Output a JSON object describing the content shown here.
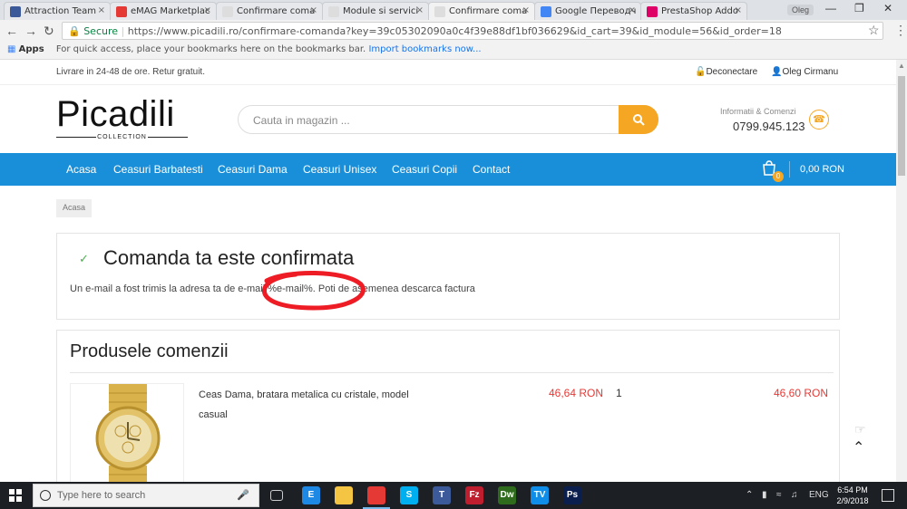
{
  "browser": {
    "tabs": [
      {
        "title": "Attraction Team",
        "color": "#3b5998",
        "active": false
      },
      {
        "title": "eMAG Marketplac",
        "color": "#e53935",
        "active": false
      },
      {
        "title": "Confirmare coma",
        "color": "#dddddd",
        "active": false
      },
      {
        "title": "Module si servici",
        "color": "#dddddd",
        "active": false
      },
      {
        "title": "Confirmare coma",
        "color": "#dddddd",
        "active": true
      },
      {
        "title": "Google Переводч",
        "color": "#4285f4",
        "active": false
      },
      {
        "title": "PrestaShop Addo",
        "color": "#df0067",
        "active": false
      }
    ],
    "profile": "Oleg",
    "secure_label": "Secure",
    "url": "https://www.picadili.ro/confirmare-comanda?key=39c05302090a0c4f39e88df1bf036629&id_cart=39&id_module=56&id_order=18",
    "bookmarks": {
      "apps": "Apps",
      "hint": "For quick access, place your bookmarks here on the bookmarks bar.",
      "import_link": "Import bookmarks now..."
    }
  },
  "site": {
    "shipping_note": "Livrare in 24-48 de ore. Retur gratuit.",
    "logout": "Deconectare",
    "user": "Oleg Cirmanu",
    "logo": "Picadili",
    "logo_sub": "COLLECTION",
    "search_placeholder": "Cauta in magazin ...",
    "contact_label": "Informatii & Comenzi",
    "contact_phone": "0799.945.123",
    "nav": [
      "Acasa",
      "Ceasuri Barbatesti",
      "Ceasuri Dama",
      "Ceasuri Unisex",
      "Ceasuri Copii",
      "Contact"
    ],
    "cart_count": "0",
    "cart_total": "0,00 RON",
    "accent": "#1a8fd9",
    "orange": "#f5a623"
  },
  "breadcrumb": "Acasa",
  "confirmation": {
    "title": "Comanda ta este confirmata",
    "text": "Un e-mail a fost trimis la adresa ta de e-mail %e-mail%. Poti de asemenea descarca factura"
  },
  "products": {
    "title": "Produsele comenzii",
    "items": [
      {
        "name": "Ceas Dama, bratara metalica cu cristale, model casual",
        "price": "46,64 RON",
        "qty": "1",
        "total": "46,60 RON"
      }
    ]
  },
  "taskbar": {
    "search_placeholder": "Type here to search",
    "apps": [
      {
        "label": "E",
        "color": "#1e88e5"
      },
      {
        "label": "",
        "color": "#f4c542"
      },
      {
        "label": "",
        "color": "#e53935"
      },
      {
        "label": "S",
        "color": "#00aff0"
      },
      {
        "label": "T",
        "color": "#3c5a99"
      },
      {
        "label": "Fz",
        "color": "#bf1e2e"
      },
      {
        "label": "Dw",
        "color": "#2f6b1c"
      },
      {
        "label": "TV",
        "color": "#0e8ee9"
      },
      {
        "label": "Ps",
        "color": "#0a1f4d"
      }
    ],
    "lang": "ENG",
    "time": "6:54 PM",
    "date": "2/9/2018"
  }
}
